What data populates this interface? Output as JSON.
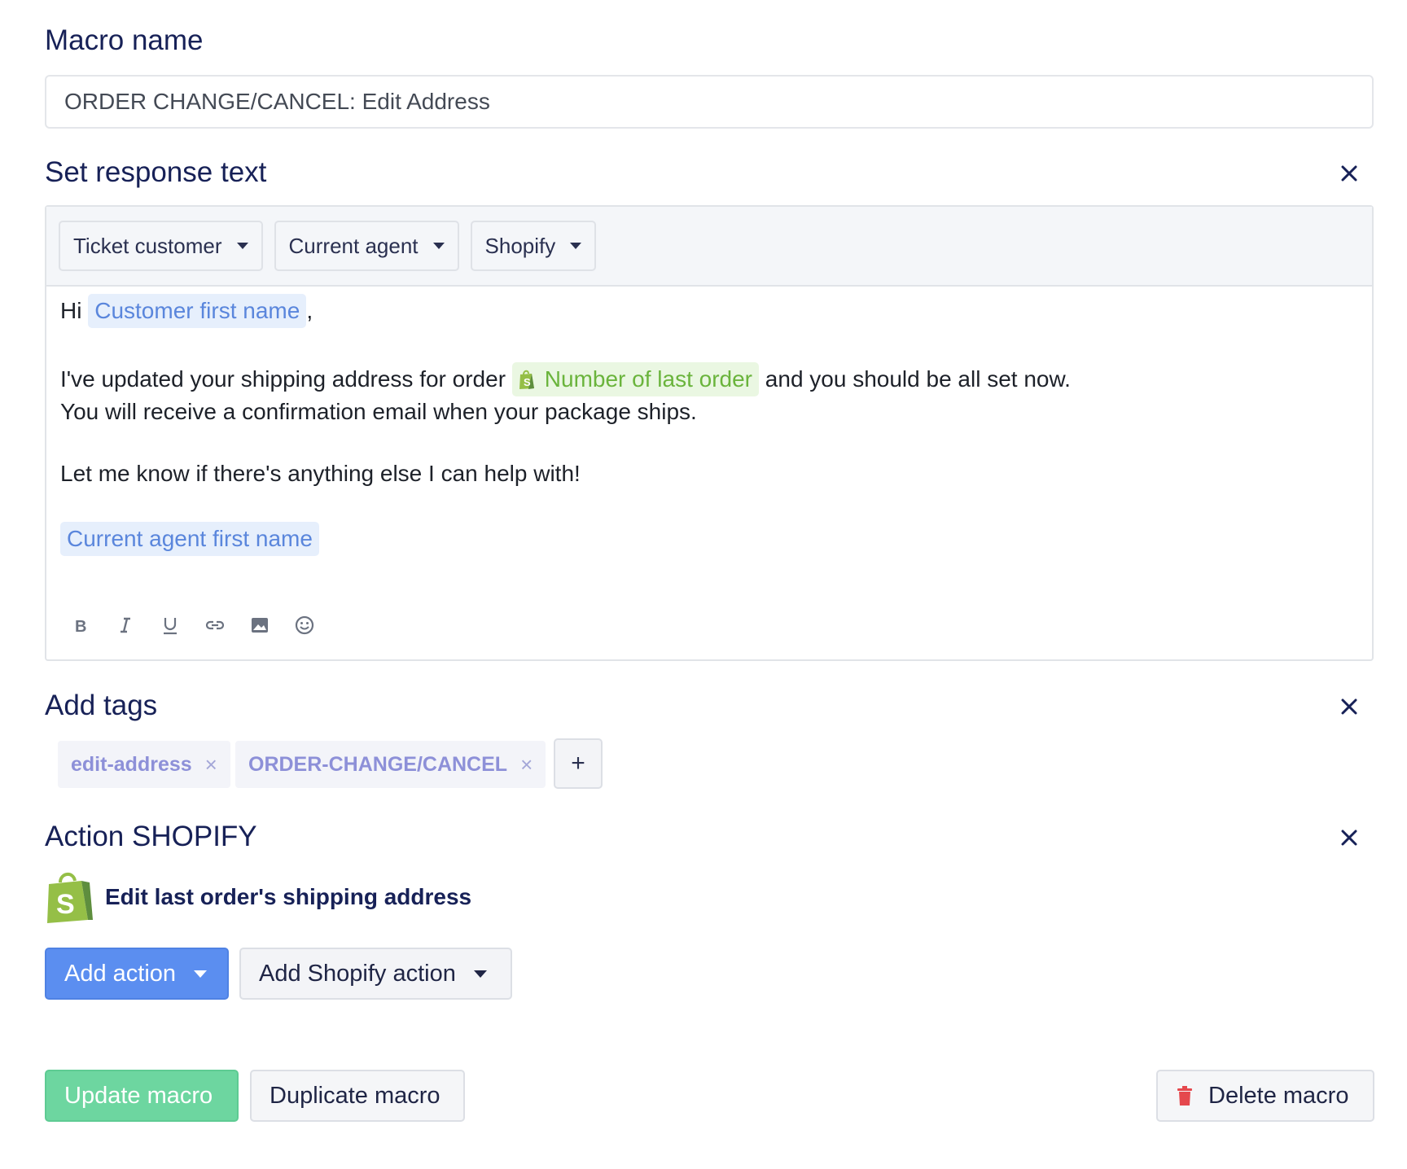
{
  "macro": {
    "title": "Macro name",
    "name_value": "ORDER CHANGE/CANCEL: Edit Address"
  },
  "response": {
    "title": "Set response text",
    "close_icon": "close-icon",
    "variable_menus": [
      {
        "label": "Ticket customer"
      },
      {
        "label": "Current agent"
      },
      {
        "label": "Shopify"
      }
    ],
    "body": {
      "greeting": "Hi",
      "customer_first_name_chip": "Customer first name",
      "comma": ",",
      "line2_before": "I've updated your shipping address for order",
      "last_order_chip": "Number of last order",
      "line2_after": "and you should be all set now.",
      "line3": "You will receive a confirmation email when your package ships.",
      "line4": "Let me know if there's anything else I can help with!",
      "agent_first_name_chip": "Current agent first name"
    },
    "formatting_icons": [
      "bold-icon",
      "italic-icon",
      "underline-icon",
      "link-icon",
      "image-icon",
      "emoji-icon"
    ]
  },
  "tags": {
    "title": "Add tags",
    "items": [
      {
        "label": "edit-address"
      },
      {
        "label": "ORDER-CHANGE/CANCEL"
      }
    ],
    "remove_symbol": "×",
    "add_symbol": "+"
  },
  "action": {
    "title": "Action SHOPIFY",
    "description": "Edit last order's shipping address",
    "add_action_label": "Add action",
    "add_shopify_action_label": "Add Shopify action"
  },
  "footer": {
    "update_label": "Update macro",
    "duplicate_label": "Duplicate macro",
    "delete_label": "Delete macro"
  },
  "colors": {
    "accent_blue": "#5b8ef0",
    "update_green": "#6dd6a0",
    "shopify_green": "#95bf47",
    "delete_red": "#e5484d"
  }
}
